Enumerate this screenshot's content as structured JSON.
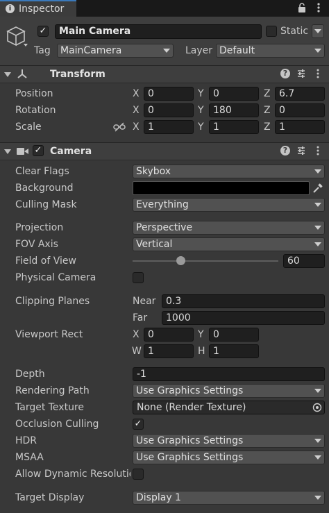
{
  "tab": {
    "icon": "info-icon",
    "title": "Inspector"
  },
  "header": {
    "name": "Main Camera",
    "static_label": "Static",
    "tag_label": "Tag",
    "tag_value": "MainCamera",
    "layer_label": "Layer",
    "layer_value": "Default"
  },
  "transform": {
    "title": "Transform",
    "position": {
      "label": "Position",
      "x": "0",
      "y": "0",
      "z": "6.7"
    },
    "rotation": {
      "label": "Rotation",
      "x": "0",
      "y": "180",
      "z": "0"
    },
    "scale": {
      "label": "Scale",
      "x": "1",
      "y": "1",
      "z": "1"
    }
  },
  "axes": {
    "x": "X",
    "y": "Y",
    "z": "Z",
    "w": "W",
    "h": "H"
  },
  "camera": {
    "title": "Camera",
    "clear_flags": {
      "label": "Clear Flags",
      "value": "Skybox"
    },
    "background": {
      "label": "Background",
      "color": "#000000"
    },
    "culling_mask": {
      "label": "Culling Mask",
      "value": "Everything"
    },
    "projection": {
      "label": "Projection",
      "value": "Perspective"
    },
    "fov_axis": {
      "label": "FOV Axis",
      "value": "Vertical"
    },
    "field_of_view": {
      "label": "Field of View",
      "value": "60",
      "min": 1,
      "max": 179
    },
    "physical_camera": {
      "label": "Physical Camera",
      "checked": false
    },
    "clipping_planes": {
      "label": "Clipping Planes",
      "near_label": "Near",
      "near": "0.3",
      "far_label": "Far",
      "far": "1000"
    },
    "viewport_rect": {
      "label": "Viewport Rect",
      "x": "0",
      "y": "0",
      "w": "1",
      "h": "1"
    },
    "depth": {
      "label": "Depth",
      "value": "-1"
    },
    "rendering_path": {
      "label": "Rendering Path",
      "value": "Use Graphics Settings"
    },
    "target_texture": {
      "label": "Target Texture",
      "value": "None (Render Texture)"
    },
    "occlusion_culling": {
      "label": "Occlusion Culling",
      "checked": true
    },
    "hdr": {
      "label": "HDR",
      "value": "Use Graphics Settings"
    },
    "msaa": {
      "label": "MSAA",
      "value": "Use Graphics Settings"
    },
    "allow_dynamic_resolution": {
      "label": "Allow Dynamic Resolutio",
      "checked": false
    },
    "target_display": {
      "label": "Target Display",
      "value": "Display 1"
    }
  },
  "colors": {
    "panel": "#383838",
    "field": "#1f1f1f",
    "dropdown": "#515151",
    "section": "#3e3e3e"
  }
}
